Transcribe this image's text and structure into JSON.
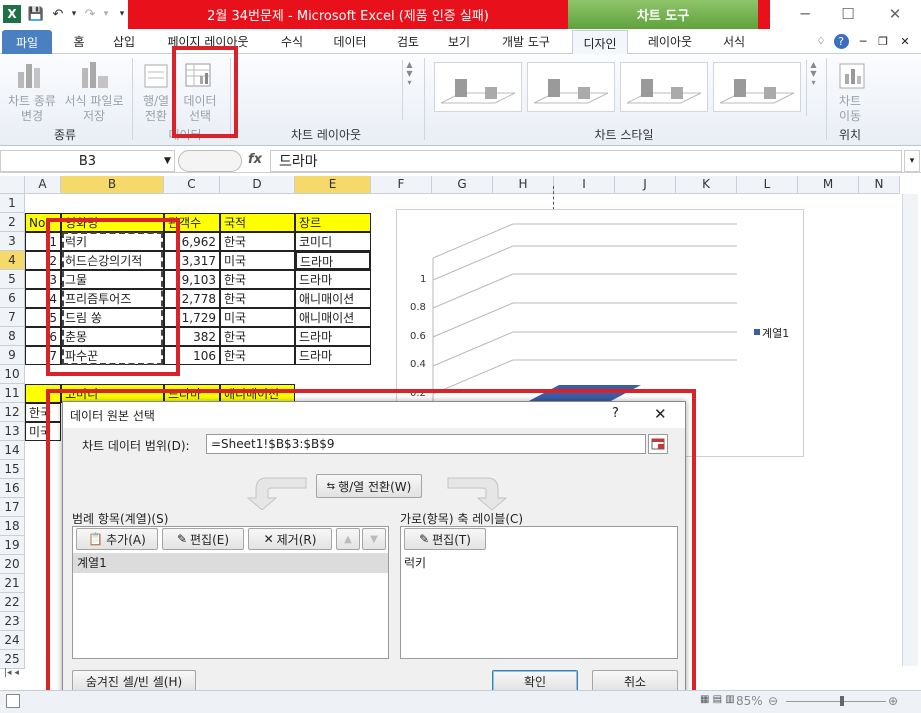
{
  "title_bar": {
    "title": "2월 34번문제 - Microsoft Excel (제품 인증 실패)",
    "chart_tools_label": "차트 도구",
    "minimize": "─",
    "restore": "☐",
    "close": "✕"
  },
  "ribbon_tabs": [
    "파일",
    "홈",
    "삽입",
    "페이지 레이아웃",
    "수식",
    "데이터",
    "검토",
    "보기",
    "개발 도구",
    "디자인",
    "레이아웃",
    "서식"
  ],
  "ribbon": {
    "change_chart_type": "차트 종류\n변경",
    "save_template": "서식 파일로\n저장",
    "group_type": "종류",
    "switch_row_col": "행/열\n전환",
    "select_data": "데이터\n선택",
    "group_data": "데이터",
    "group_chart_layouts": "차트 레이아웃",
    "group_chart_styles": "차트 스타일",
    "move_chart": "차트\n이동",
    "group_location": "위치"
  },
  "formula_bar": {
    "name_box": "B3",
    "fx": "fx",
    "content": "드라마"
  },
  "columns": [
    "A",
    "B",
    "C",
    "D",
    "E",
    "F",
    "G",
    "H",
    "I",
    "J",
    "K",
    "L",
    "M",
    "N"
  ],
  "rows": [
    "1",
    "2",
    "3",
    "4",
    "5",
    "6",
    "7",
    "8",
    "9",
    "10",
    "11",
    "12",
    "13",
    "14",
    "15",
    "16",
    "17",
    "18",
    "19",
    "20",
    "21",
    "22",
    "23",
    "24",
    "25"
  ],
  "sheet": {
    "header": {
      "a": "No",
      "b": "영화명",
      "c": "관객수",
      "d": "국적",
      "e": "장르"
    },
    "data": [
      {
        "no": "1",
        "title": "럭키",
        "audience": "6,962",
        "country": "한국",
        "genre": "코미디"
      },
      {
        "no": "2",
        "title": "허드슨강의기적",
        "audience": "3,317",
        "country": "미국",
        "genre": "드라마"
      },
      {
        "no": "3",
        "title": "그물",
        "audience": "9,103",
        "country": "한국",
        "genre": "드라마"
      },
      {
        "no": "4",
        "title": "프리즘투어즈",
        "audience": "2,778",
        "country": "한국",
        "genre": "애니매이션"
      },
      {
        "no": "5",
        "title": "드림 쏭",
        "audience": "1,729",
        "country": "미국",
        "genre": "애니매이션"
      },
      {
        "no": "6",
        "title": "춘몽",
        "audience": "382",
        "country": "한국",
        "genre": "드라마"
      },
      {
        "no": "7",
        "title": "파수꾼",
        "audience": "106",
        "country": "한국",
        "genre": "드라마"
      }
    ],
    "row11": {
      "b": "코미디",
      "c": "드라마",
      "d": "애니매이션"
    },
    "row12_a": "한국",
    "row13_a": "미국"
  },
  "chart": {
    "y_ticks": [
      "1",
      "0.8",
      "0.6",
      "0.4",
      "0.2"
    ],
    "legend": "계열1"
  },
  "dialog": {
    "title": "데이터 원본 선택",
    "help": "?",
    "close": "✕",
    "range_label": "차트 데이터 범위(D):",
    "range_value": "=Sheet1!$B$3:$B$9",
    "switch_button": "행/열 전환(W)",
    "legend_label": "범례 항목(계열)(S)",
    "add": "추가(A)",
    "edit": "편집(E)",
    "remove": "제거(R)",
    "series": [
      "계열1"
    ],
    "axis_label": "가로(항목) 축 레이블(C)",
    "axis_edit": "편집(T)",
    "axis_items": [
      "럭키"
    ],
    "hidden_cells": "숨겨진 셀/빈 셀(H)",
    "ok": "확인",
    "cancel": "취소"
  },
  "status": {
    "zoom": "85%"
  },
  "colors": {
    "title_red": "#e8101a",
    "chart_tools_green": "#5fa23c",
    "file_tab_blue": "#4a7fc1",
    "highlight_red": "#d8232a",
    "series_blue": "#3b5ea8"
  }
}
